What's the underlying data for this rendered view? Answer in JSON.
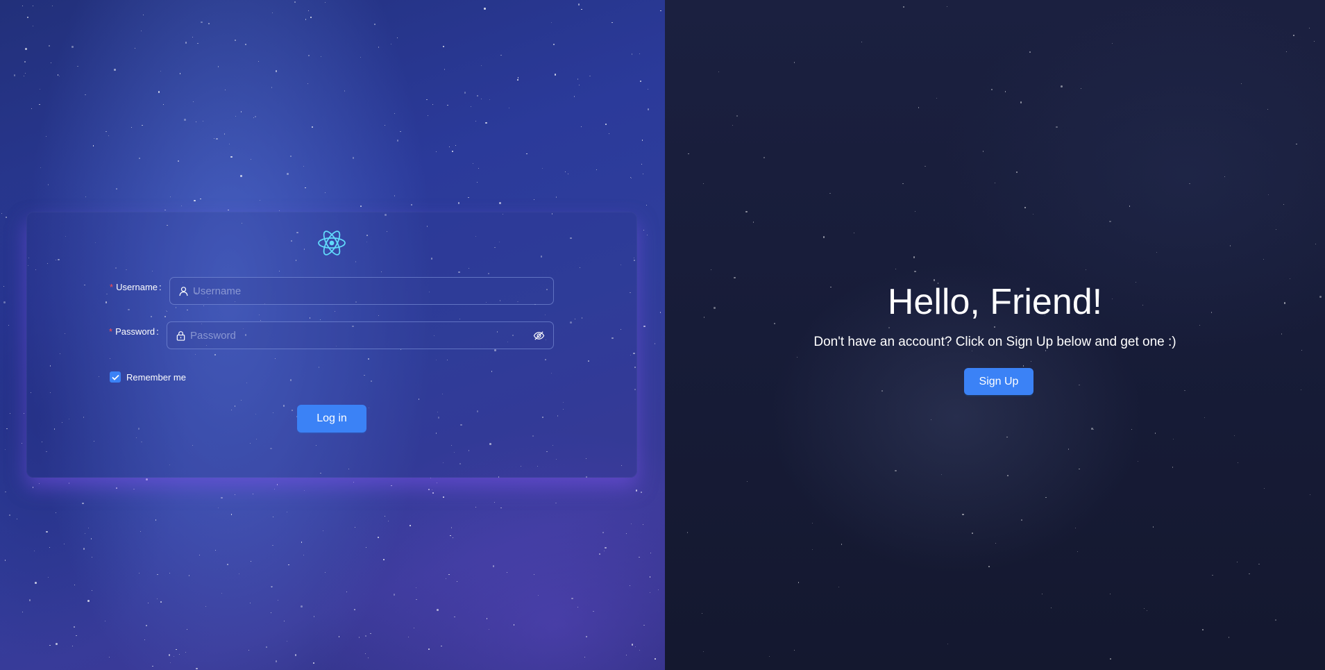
{
  "login": {
    "logo_icon": "react-atom-icon",
    "username": {
      "label": "Username",
      "required_mark": "*",
      "placeholder": "Username",
      "value": "",
      "icon": "user-icon"
    },
    "password": {
      "label": "Password",
      "required_mark": "*",
      "placeholder": "Password",
      "value": "",
      "icon": "lock-icon",
      "toggle_icon": "eye-invisible-icon"
    },
    "remember": {
      "label": "Remember me",
      "checked": true
    },
    "submit_label": "Log in"
  },
  "welcome": {
    "title": "Hello, Friend!",
    "subtitle": "Don't have an account? Click on Sign Up below and get one :)",
    "signup_label": "Sign Up"
  },
  "colors": {
    "primary": "#3b82f6",
    "required": "#ff4d4f",
    "logo": "#61dafb"
  }
}
